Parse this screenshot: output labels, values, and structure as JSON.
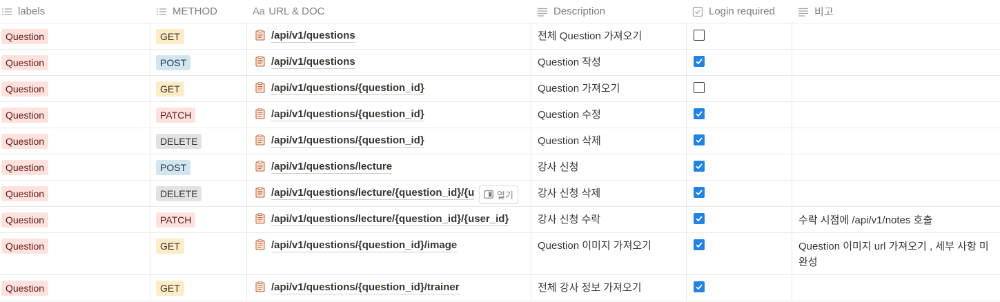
{
  "columns": {
    "labels": "labels",
    "method": "METHOD",
    "url_prefix": "Aa",
    "url": "URL & DOC",
    "description": "Description",
    "login": "Login required",
    "note": "비고"
  },
  "open_button_label": "열기",
  "colors": {
    "checkbox_checked": "#2383e2",
    "question_tag": "#ffe2dd",
    "get_tag": "#fdecc8",
    "post_tag": "#d3e5ef",
    "patch_tag": "#ffe2dd",
    "delete_tag": "#e3e2e0"
  },
  "rows": [
    {
      "label": "Question",
      "method": "GET",
      "url": "/api/v1/questions",
      "description": "전체 Question 가져오기",
      "login": false,
      "note": ""
    },
    {
      "label": "Question",
      "method": "POST",
      "url": "/api/v1/questions",
      "description": "Question 작성",
      "login": true,
      "note": ""
    },
    {
      "label": "Question",
      "method": "GET",
      "url": "/api/v1/questions/{question_id}",
      "description": "Question 가져오기",
      "login": false,
      "note": ""
    },
    {
      "label": "Question",
      "method": "PATCH",
      "url": "/api/v1/questions/{question_id}",
      "description": "Question 수정",
      "login": true,
      "note": ""
    },
    {
      "label": "Question",
      "method": "DELETE",
      "url": "/api/v1/questions/{question_id}",
      "description": "Question 삭제",
      "login": true,
      "note": ""
    },
    {
      "label": "Question",
      "method": "POST",
      "url": "/api/v1/questions/lecture",
      "description": "강사 신청",
      "login": true,
      "note": ""
    },
    {
      "label": "Question",
      "method": "DELETE",
      "url": "/api/v1/questions/lecture/{question_id}/{u",
      "description": "강사 신청 삭제",
      "login": true,
      "note": ""
    },
    {
      "label": "Question",
      "method": "PATCH",
      "url": "/api/v1/questions/lecture/{question_id}/{user_id}",
      "description": "강사 신청 수락",
      "login": true,
      "note": "수락 시점에 /api/v1/notes 호출"
    },
    {
      "label": "Question",
      "method": "GET",
      "url": "/api/v1/questions/{question_id}/image",
      "description": "Question 이미지 가져오기",
      "login": true,
      "note": "Question 이미지 url 가져오기 , 세부 사항 미완성"
    },
    {
      "label": "Question",
      "method": "GET",
      "url": "/api/v1/questions/{question_id}/trainer",
      "description": "전체 강사 정보 가져오기",
      "login": true,
      "note": ""
    }
  ]
}
